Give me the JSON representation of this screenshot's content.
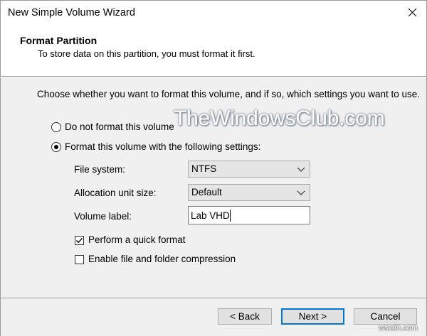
{
  "window": {
    "title": "New Simple Volume Wizard"
  },
  "header": {
    "title": "Format Partition",
    "subtitle": "To store data on this partition, you must format it first."
  },
  "main": {
    "intro": "Choose whether you want to format this volume, and if so, which settings you want to use.",
    "watermark": "TheWindowsClub.com",
    "options": {
      "no_format_label": "Do not format this volume",
      "format_label": "Format this volume with the following settings:",
      "selected": "format"
    },
    "settings": {
      "file_system": {
        "label": "File system:",
        "value": "NTFS"
      },
      "allocation_unit": {
        "label": "Allocation unit size:",
        "value": "Default"
      },
      "volume_label": {
        "label": "Volume label:",
        "value": "Lab VHD"
      }
    },
    "checkboxes": {
      "quick_format": {
        "label": "Perform a quick format",
        "checked": true
      },
      "compression": {
        "label": "Enable file and folder compression",
        "checked": false
      }
    }
  },
  "footer": {
    "back_label": "< Back",
    "next_label": "Next >",
    "cancel_label": "Cancel"
  },
  "corner_watermark": "wsxdn.com",
  "colors": {
    "dialog_bg": "#f0f0f0",
    "header_bg": "#ffffff",
    "default_button_border": "#0078d7"
  }
}
